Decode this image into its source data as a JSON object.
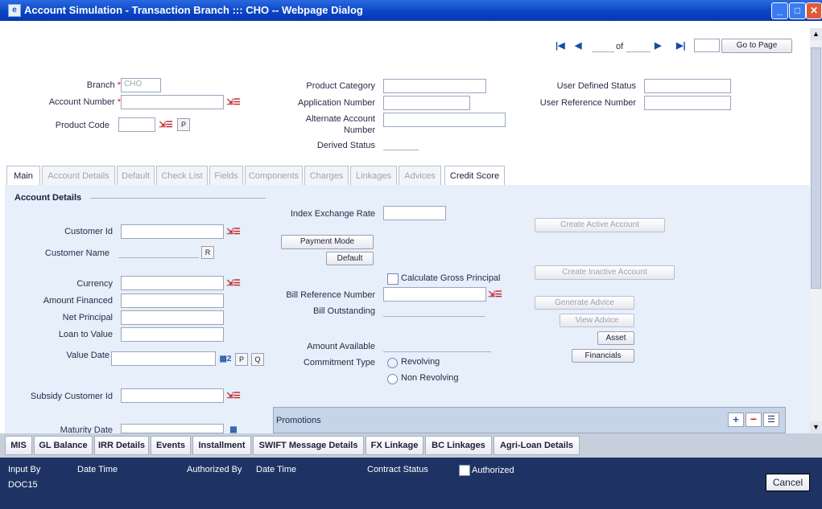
{
  "window": {
    "title": "Account Simulation - Transaction Branch ::: CHO -- Webpage Dialog"
  },
  "paging": {
    "of_label": "of",
    "go_label": "Go to Page"
  },
  "header": {
    "branch_label": "Branch",
    "branch_value": "CHO",
    "account_number_label": "Account Number",
    "product_code_label": "Product Code",
    "product_category_label": "Product Category",
    "application_number_label": "Application Number",
    "alternate_account_label_1": "Alternate Account",
    "alternate_account_label_2": "Number",
    "derived_status_label": "Derived Status",
    "user_defined_status_label": "User Defined Status",
    "user_reference_number_label": "User Reference Number",
    "required_mark": "*",
    "p_label": "P"
  },
  "tabs": [
    "Main",
    "Account Details",
    "Default",
    "Check List",
    "Fields",
    "Components",
    "Charges",
    "Linkages",
    "Advices",
    "Credit Score"
  ],
  "main": {
    "section_title": "Account Details",
    "customer_id_label": "Customer Id",
    "customer_name_label": "Customer Name",
    "r_label": "R",
    "currency_label": "Currency",
    "amount_financed_label": "Amount Financed",
    "net_principal_label": "Net Principal",
    "loan_to_value_label": "Loan to Value",
    "value_date_label": "Value Date",
    "p_label": "P",
    "q_label": "Q",
    "subsidy_customer_label": "Subsidy Customer Id",
    "maturity_date_label": "Maturity Date",
    "index_exchange_rate_label": "Index Exchange Rate",
    "payment_mode_label": "Payment Mode",
    "default_label": "Default",
    "calc_gross_label": "Calculate Gross Principal",
    "bill_ref_label": "Bill Reference Number",
    "bill_outstanding_label": "Bill Outstanding",
    "amount_available_label": "Amount Available",
    "commitment_type_label": "Commitment Type",
    "revolving_label": "Revolving",
    "non_revolving_label": "Non Revolving",
    "create_active_label": "Create Active Account",
    "create_inactive_label": "Create Inactive Account",
    "generate_advice_label": "Generate Advice",
    "view_advice_label": "View Advice",
    "asset_label": "Asset",
    "financials_label": "Financials",
    "promotions_label": "Promotions"
  },
  "bottom_tabs": [
    "MIS",
    "GL Balance",
    "IRR Details",
    "Events",
    "Installment",
    "SWIFT Message Details",
    "FX Linkage",
    "BC Linkages",
    "Agri-Loan Details"
  ],
  "footer": {
    "input_by_label": "Input By",
    "input_by_value": "DOC15",
    "date_time_label": "Date Time",
    "authorized_by_label": "Authorized By",
    "date_time_label_2": "Date Time",
    "contract_status_label": "Contract Status",
    "authorized_label": "Authorized",
    "cancel_label": "Cancel"
  }
}
